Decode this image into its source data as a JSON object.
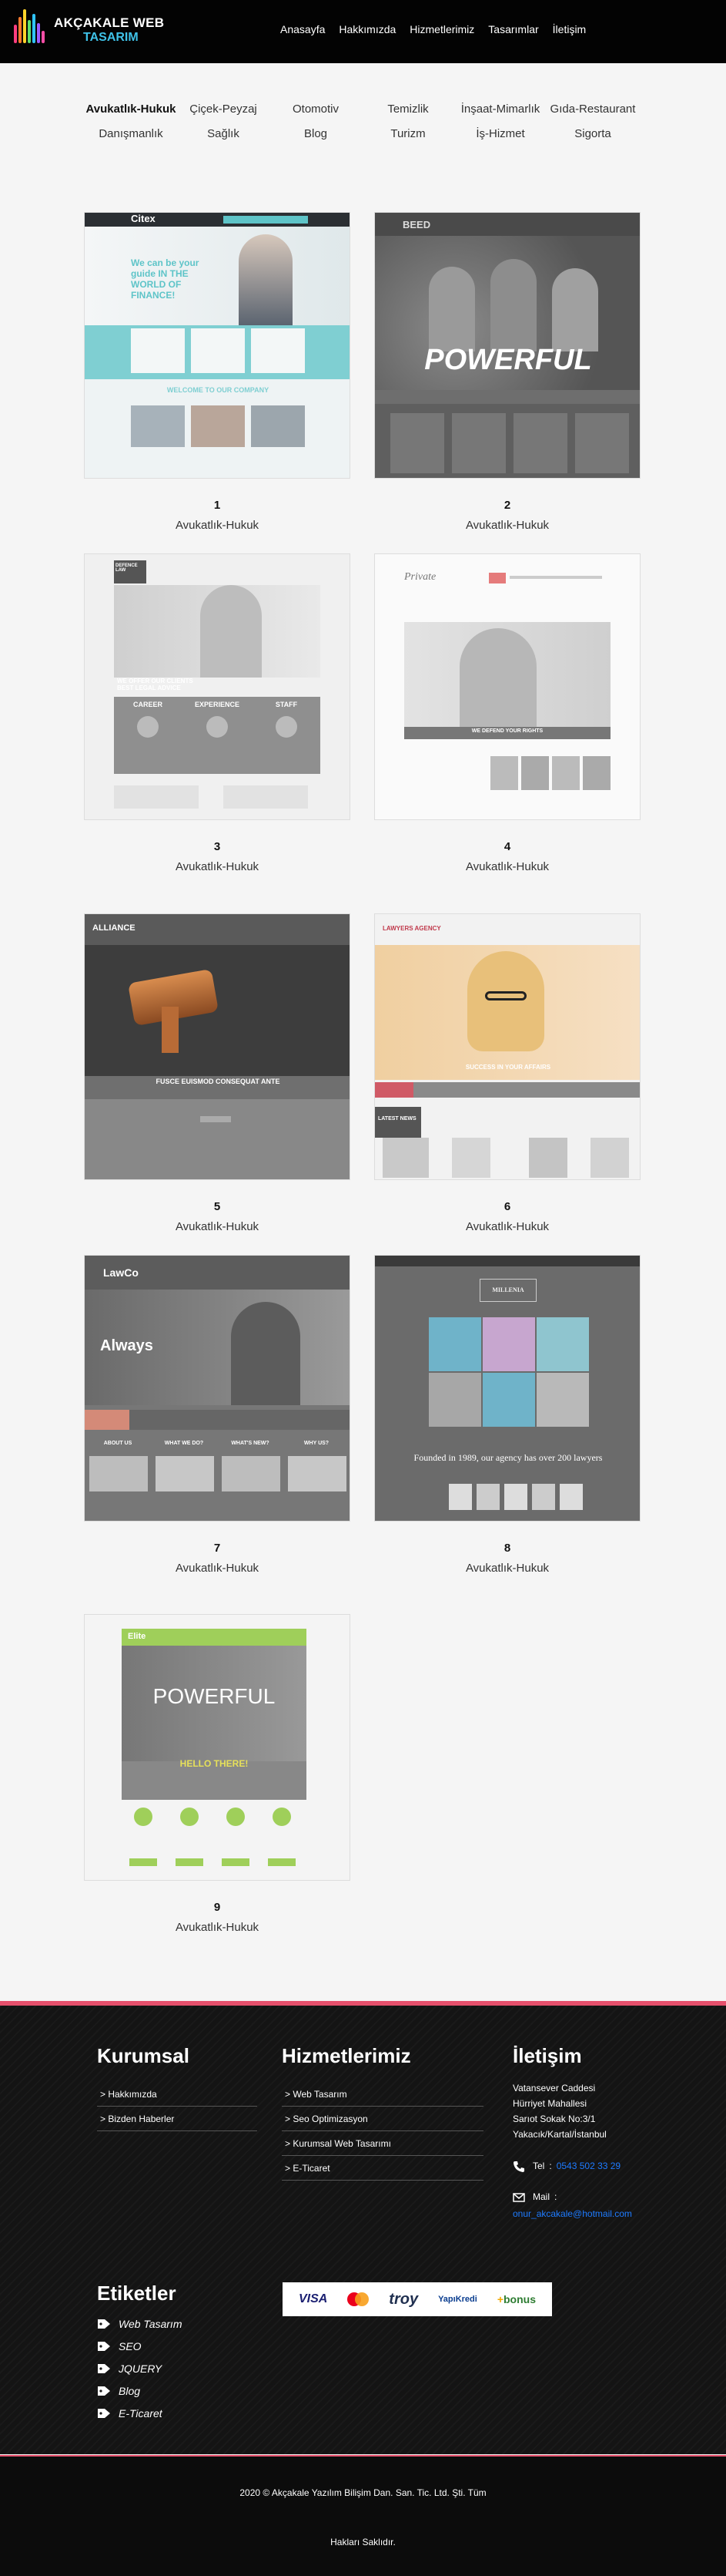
{
  "header": {
    "logo_line1": "AKÇAKALE WEB",
    "logo_line2": "TASARIM",
    "nav": [
      "Anasayfa",
      "Hakkımızda",
      "Hizmetlerimiz",
      "Tasarımlar",
      "İletişim"
    ]
  },
  "filters": {
    "row1": [
      "Avukatlık-Hukuk",
      "Çiçek-Peyzaj",
      "Otomotiv",
      "Temizlik",
      "İnşaat-Mimarlık",
      "Gıda-Restaurant"
    ],
    "row2": [
      "Danışmanlık",
      "Sağlık",
      "Blog",
      "Turizm",
      "İş-Hizmet",
      "Sigorta"
    ],
    "active": "Avukatlık-Hukuk"
  },
  "gallery": [
    {
      "number": "1",
      "category": "Avukatlık-Hukuk",
      "hero": "We can be your guide IN THE WORLD OF FINANCE!",
      "brand": "Citex",
      "welcome": "WELCOME TO OUR COMPANY"
    },
    {
      "number": "2",
      "category": "Avukatlık-Hukuk",
      "hero": "POWERFUL",
      "brand": "BEED"
    },
    {
      "number": "3",
      "category": "Avukatlık-Hukuk",
      "hero": "WE OFFER OUR CLIENTS BEST LEGAL ADVICE",
      "brand": "DEFENCE LAW",
      "cols": [
        "CAREER",
        "EXPERIENCE",
        "STAFF"
      ]
    },
    {
      "number": "4",
      "category": "Avukatlık-Hukuk",
      "hero": "WE DEFEND YOUR RIGHTS",
      "brand": "Private"
    },
    {
      "number": "5",
      "category": "Avukatlık-Hukuk",
      "hero": "FUSCE EUISMOD CONSEQUAT ANTE",
      "brand": "ALLIANCE"
    },
    {
      "number": "6",
      "category": "Avukatlık-Hukuk",
      "hero": "SUCCESS IN YOUR AFFAIRS",
      "brand": "LAWYERS AGENCY",
      "latest": "LATEST NEWS"
    },
    {
      "number": "7",
      "category": "Avukatlık-Hukuk",
      "hero": "Always",
      "brand": "LawCo",
      "cols": [
        "ABOUT US",
        "WHAT WE DO?",
        "WHAT'S NEW?",
        "WHY US?"
      ]
    },
    {
      "number": "8",
      "category": "Avukatlık-Hukuk",
      "hero": "Founded in 1989, our agency has over 200 lawyers",
      "brand": "MILLENIA"
    },
    {
      "number": "9",
      "category": "Avukatlık-Hukuk",
      "hero": "POWERFUL",
      "brand": "Elite",
      "hello": "HELLO THERE!"
    }
  ],
  "footer": {
    "kurumsal": {
      "title": "Kurumsal",
      "items": [
        "> Hakkımızda",
        "> Bizden Haberler"
      ]
    },
    "hizmetler": {
      "title": "Hizmetlerimiz",
      "items": [
        "> Web Tasarım",
        "> Seo Optimizasyon",
        "> Kurumsal Web Tasarımı",
        "> E-Ticaret"
      ]
    },
    "iletisim": {
      "title": "İletişim",
      "address": [
        "Vatansever Caddesi",
        "Hürriyet Mahallesi",
        "Sarıot Sokak No:3/1",
        "Yakacık/Kartal/İstanbul"
      ],
      "tel_label": "Tel",
      "tel": "0543 502 33 29",
      "mail_label": "Mail",
      "mail": "onur_akcakale@hotmail.com"
    },
    "etiketler": {
      "title": "Etiketler",
      "items": [
        "Web Tasarım",
        "SEO",
        "JQUERY",
        "Blog",
        "E-Ticaret"
      ]
    },
    "payments": [
      "VISA",
      "troy",
      "YapıKredi",
      "bonus"
    ],
    "copyright": "2020 © Akçakale Yazılım Bilişim Dan. San. Tic. Ltd. Şti. Tüm",
    "rights": "Hakları Saklıdır."
  },
  "colors": {
    "accent": "#e6506c",
    "link": "#1e7bff",
    "logo_blue": "#3fc2e8",
    "teal": "#5ec4c8",
    "green": "#9fcf5a"
  }
}
